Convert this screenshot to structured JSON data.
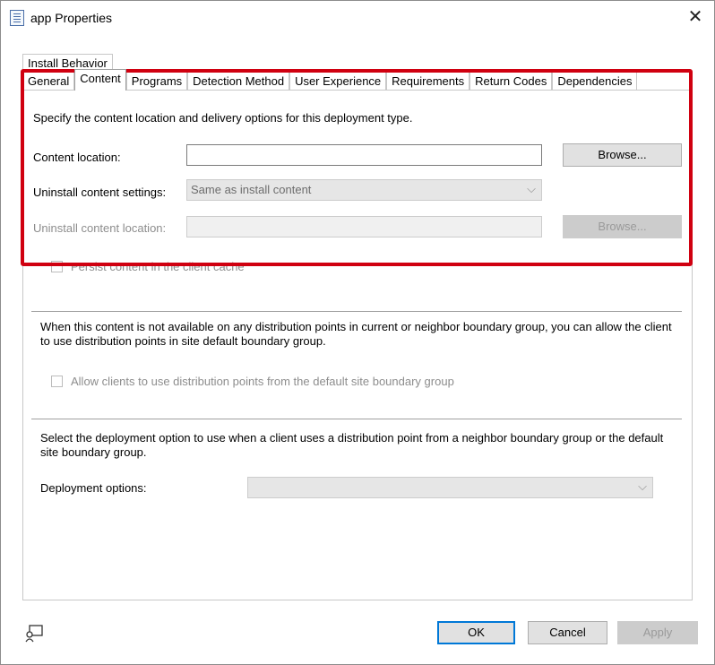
{
  "window": {
    "title": "app Properties",
    "close_glyph": "✕",
    "icon": "properties-icon"
  },
  "tabs": {
    "row1": [
      "Install Behavior"
    ],
    "row2": [
      "General",
      "Content",
      "Programs",
      "Detection Method",
      "User Experience",
      "Requirements",
      "Return Codes",
      "Dependencies"
    ],
    "active": "Content"
  },
  "content_group": {
    "description": "Specify the content location and delivery options for this deployment type.",
    "content_location_label": "Content location:",
    "content_location_value": "",
    "browse_label": "Browse...",
    "uninstall_settings_label": "Uninstall content settings:",
    "uninstall_settings_value": "Same as install content",
    "uninstall_location_label": "Uninstall content location:",
    "uninstall_location_value": "",
    "browse2_label": "Browse...",
    "persist_label": "Persist content in the client cache",
    "highlight_color": "#d00010"
  },
  "fallback_group": {
    "description": "When this content is not available on any distribution points in current or neighbor boundary group, you can allow the client to use distribution points in site default boundary group.",
    "allow_label": "Allow clients to use distribution points from the default site boundary group"
  },
  "deployment_group": {
    "description": "Select the deployment option to use when a client uses a distribution point from a neighbor boundary group or the default site boundary group.",
    "deployment_options_label": "Deployment options:",
    "deployment_options_value": ""
  },
  "footer": {
    "help_icon": "help-pointer-icon",
    "ok_label": "OK",
    "cancel_label": "Cancel",
    "apply_label": "Apply"
  }
}
